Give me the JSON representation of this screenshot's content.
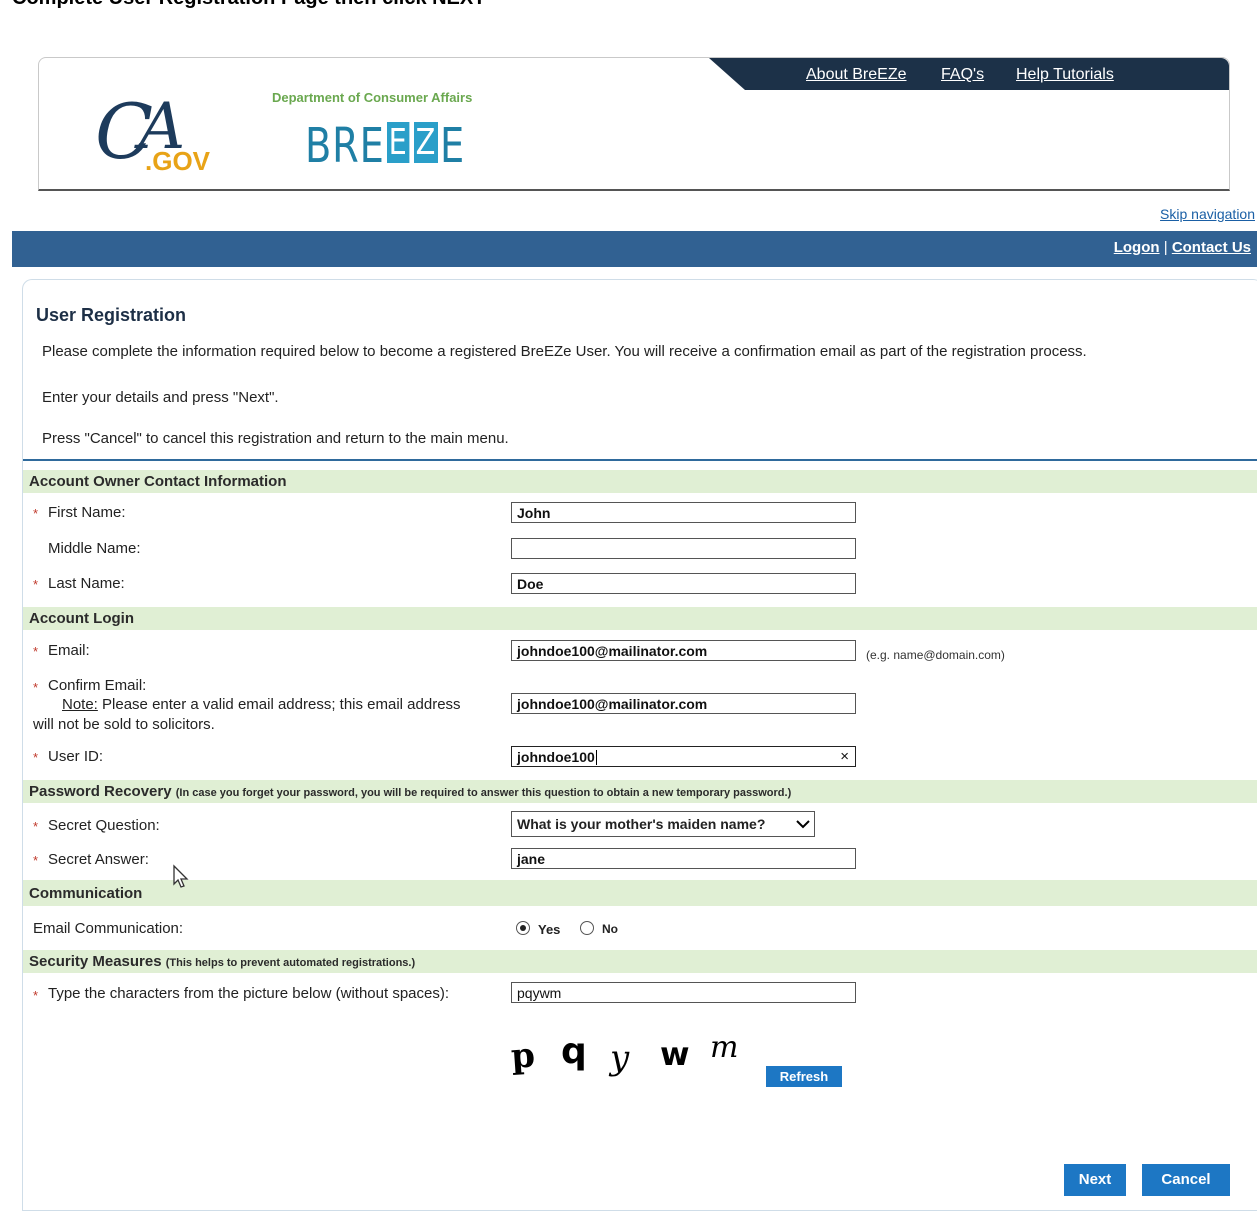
{
  "instruction": "Complete User Registration Page then click NEXT",
  "header": {
    "links": [
      "About BreEZe",
      "FAQ's",
      "Help Tutorials"
    ],
    "ca_gov": ".GOV",
    "dept": "Department of Consumer Affairs",
    "breeze": [
      "BRE",
      "E",
      "Z",
      "E"
    ]
  },
  "skip_navigation": "Skip navigation",
  "nav": {
    "logon": "Logon",
    "sep": "|",
    "contact": "Contact Us"
  },
  "page": {
    "title": "User Registration",
    "intro1": "Please complete the information required below to become a registered BreEZe User. You will receive a confirmation email as part of the registration process.",
    "intro2": "Enter your details and press \"Next\".",
    "intro3": "Press \"Cancel\" to cancel this registration and return to the main menu."
  },
  "sections": {
    "contact": "Account Owner Contact Information",
    "login": "Account Login",
    "recovery": "Password Recovery",
    "recovery_note": "(In case you forget your password, you will be required to answer this question to obtain a new temporary password.)",
    "communication": "Communication",
    "security": "Security Measures",
    "security_note": "(This helps to prevent automated registrations.)"
  },
  "fields": {
    "first_name": {
      "label": "First Name:",
      "value": "John"
    },
    "middle_name": {
      "label": "Middle Name:",
      "value": ""
    },
    "last_name": {
      "label": "Last Name:",
      "value": "Doe"
    },
    "email": {
      "label": "Email:",
      "value": "johndoe100@mailinator.com",
      "hint": "(e.g. name@domain.com)"
    },
    "confirm_email": {
      "label": "Confirm Email:",
      "note_label": "Note:",
      "note": "Please enter a valid email address; this email address",
      "note2": "will not be sold to solicitors.",
      "value": "johndoe100@mailinator.com"
    },
    "user_id": {
      "label": "User ID:",
      "value": "johndoe100",
      "clear": "×"
    },
    "secret_question": {
      "label": "Secret Question:",
      "value": "What is your mother's maiden name?"
    },
    "secret_answer": {
      "label": "Secret Answer:",
      "value": "jane"
    },
    "email_comm": {
      "label": "Email Communication:",
      "yes": "Yes",
      "no": "No",
      "selected": "Yes"
    },
    "captcha": {
      "label": "Type the characters from the picture below (without spaces):",
      "value": "pqywm",
      "image_text": "pqywm"
    }
  },
  "required_mark": "*",
  "buttons": {
    "refresh": "Refresh",
    "next": "Next",
    "cancel": "Cancel"
  }
}
